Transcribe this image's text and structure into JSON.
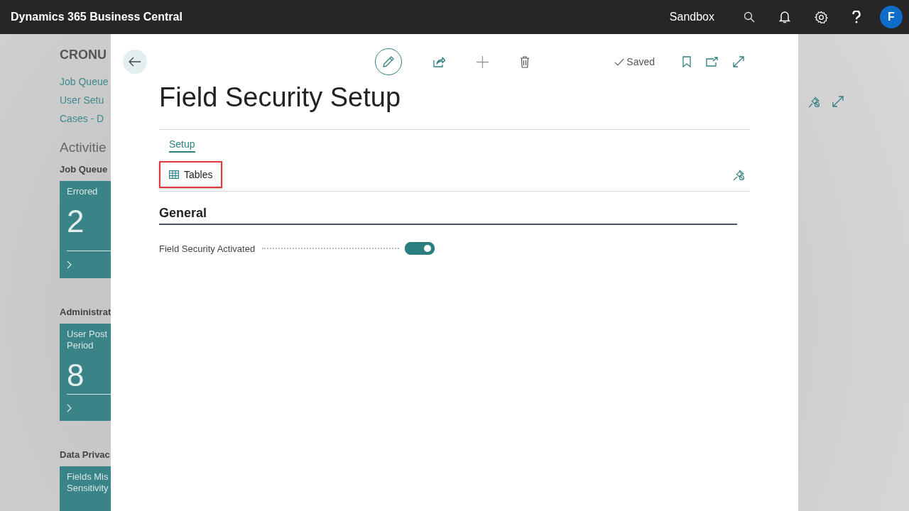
{
  "app_bar": {
    "title": "Dynamics 365 Business Central",
    "environment": "Sandbox",
    "avatar": "F"
  },
  "background_page": {
    "company": "CRONU",
    "links": [
      "Job Queue",
      "User Setu",
      "Cases - D"
    ],
    "heading": "Activitie",
    "groups": [
      {
        "title": "Job Queue",
        "tiles": [
          {
            "label_lines": [
              "Errored"
            ],
            "value": "2"
          }
        ]
      },
      {
        "title": "Administrat",
        "tiles": [
          {
            "label_lines": [
              "User Post",
              "Period"
            ],
            "value": "8"
          }
        ]
      },
      {
        "title": "Data Privac",
        "tiles": [
          {
            "label_lines": [
              "Fields Mis",
              "Sensitivity"
            ]
          }
        ]
      }
    ]
  },
  "dialog": {
    "status": "Saved",
    "title": "Field Security Setup",
    "action_tabs": [
      {
        "label": "Setup",
        "selected": true
      }
    ],
    "actions": [
      {
        "label": "Tables",
        "highlighted": true
      }
    ],
    "sections": [
      {
        "title": "General",
        "fields": [
          {
            "label": "Field Security Activated",
            "kind": "toggle",
            "on": true
          }
        ]
      }
    ]
  }
}
